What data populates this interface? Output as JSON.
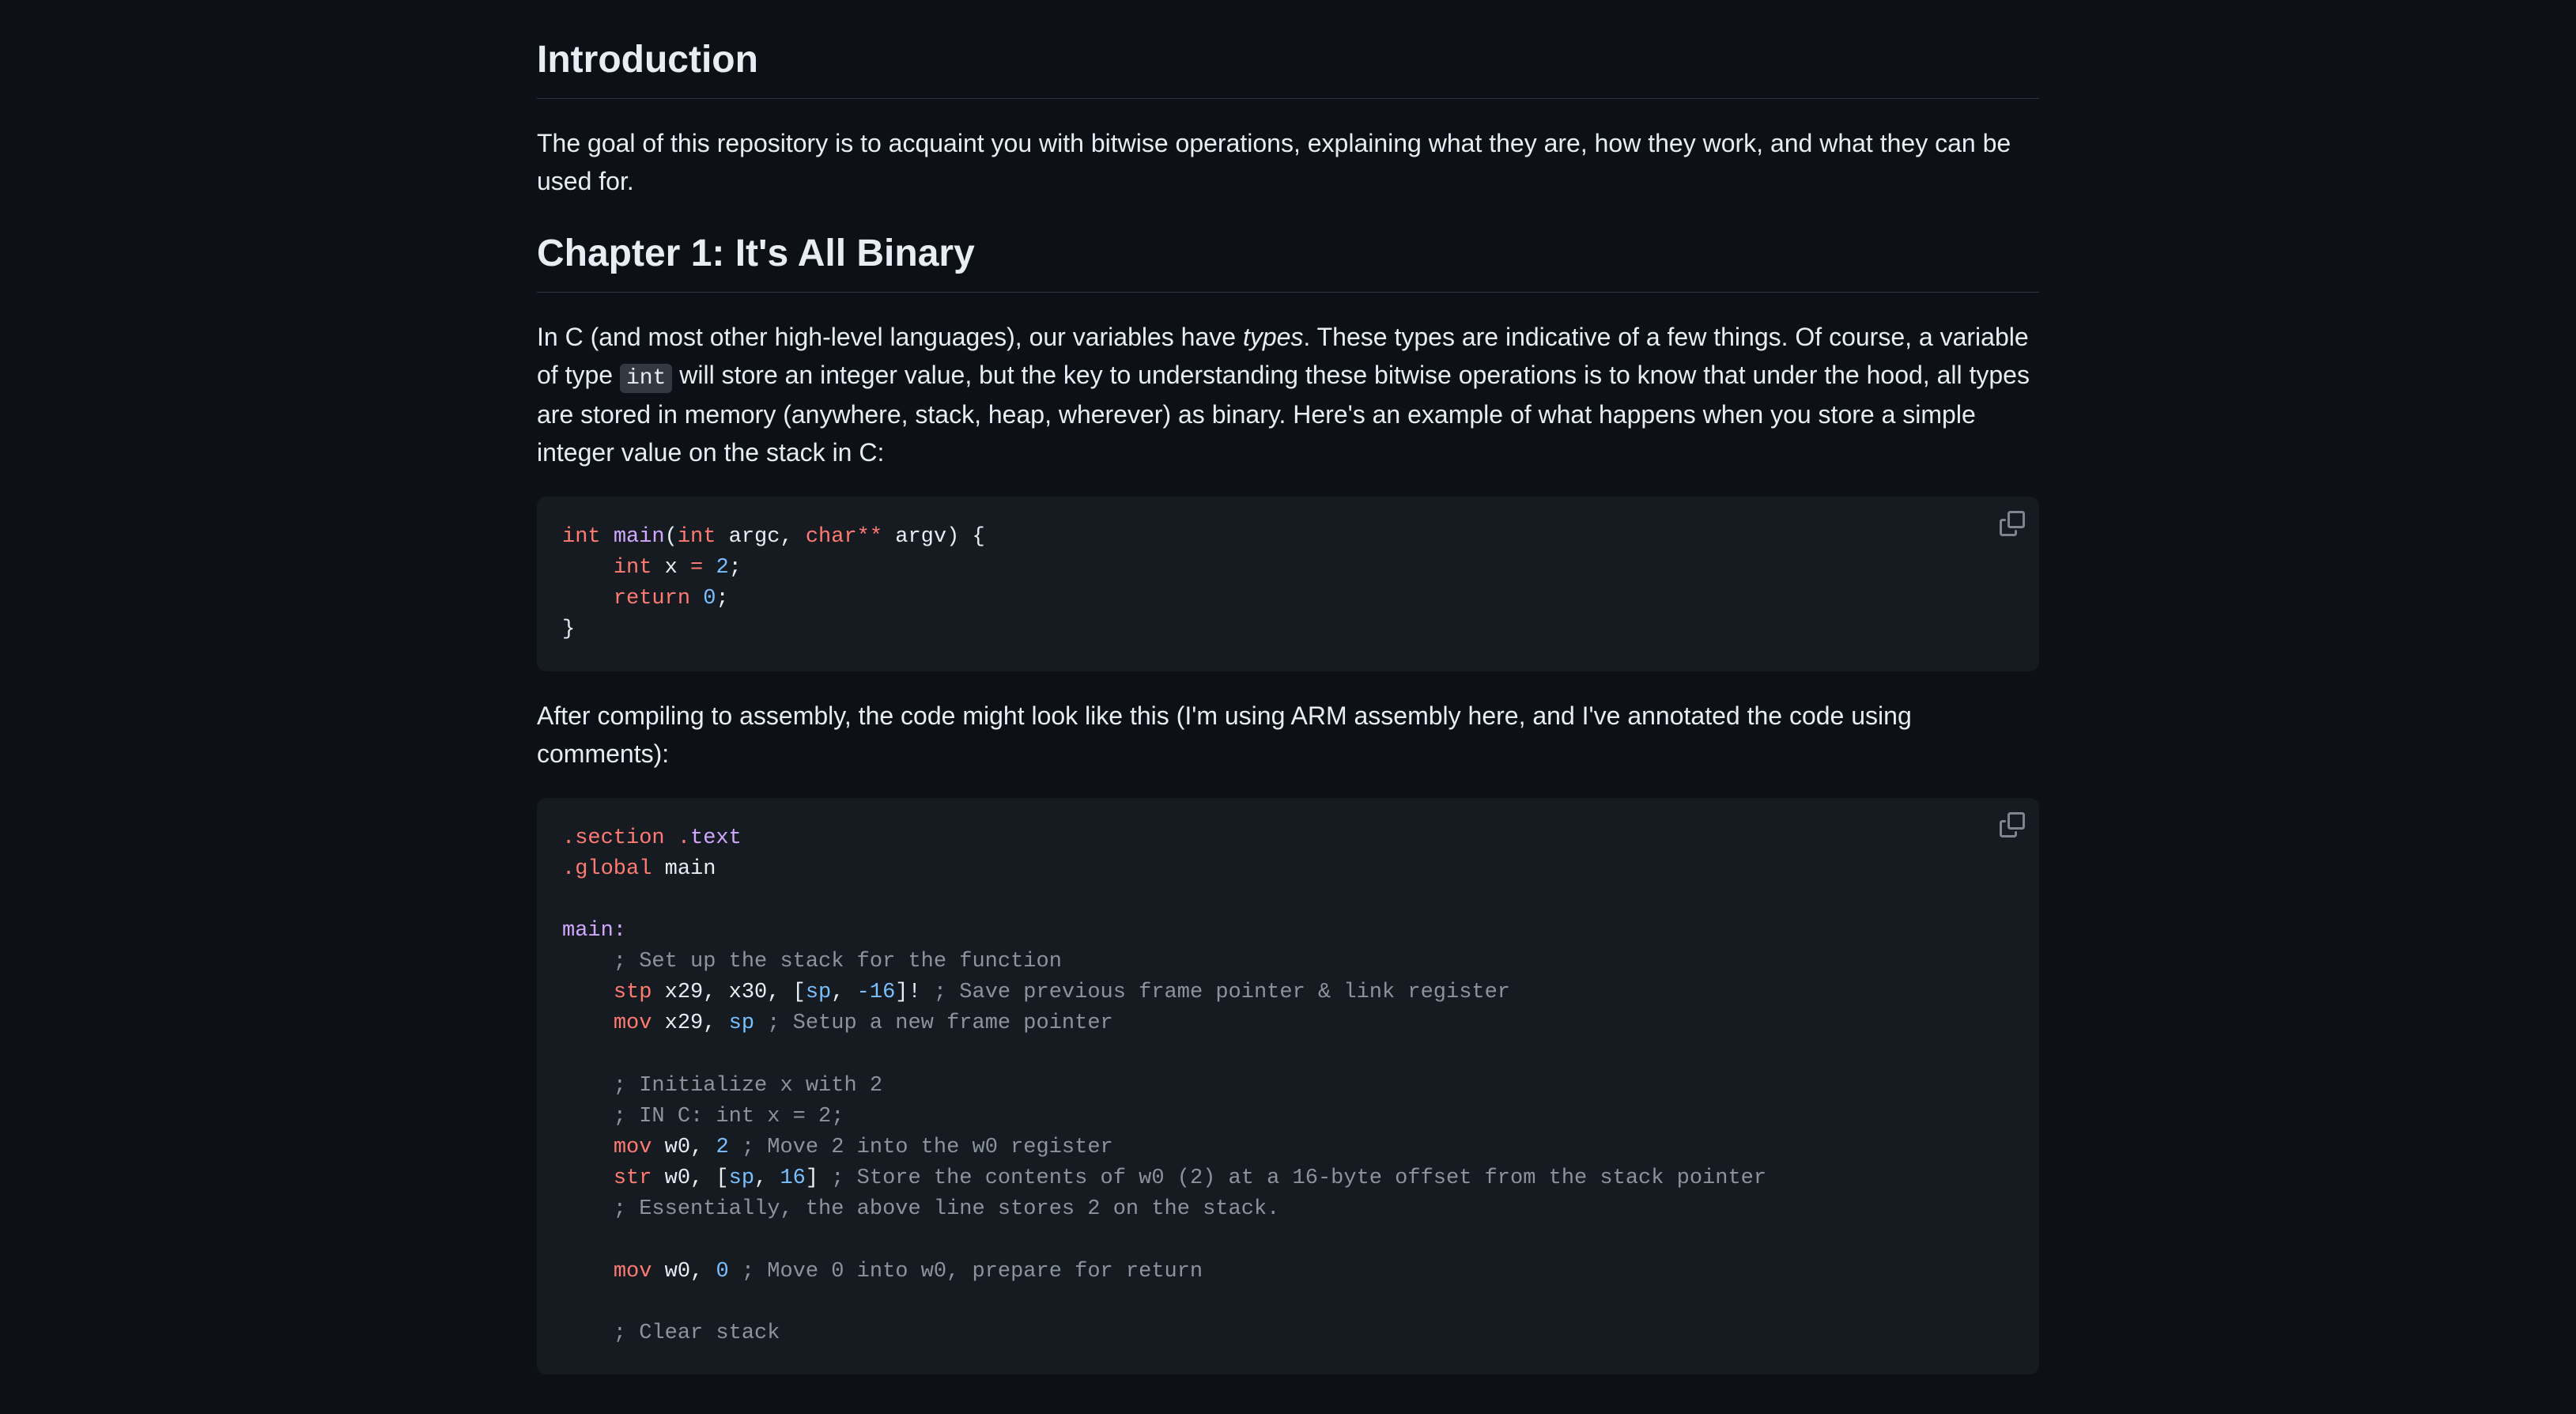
{
  "introduction": {
    "heading": "Introduction",
    "text": "The goal of this repository is to acquaint you with bitwise operations, explaining what they are, how they work, and what they can be used for."
  },
  "chapter1": {
    "heading": "Chapter 1: It's All Binary",
    "para1_prefix": "In C (and most other high-level languages), our variables have ",
    "para1_types": "types",
    "para1_mid1": ". These types are indicative of a few things. Of course, a variable of type ",
    "para1_code": "int",
    "para1_suffix": " will store an integer value, but the key to understanding these bitwise operations is to know that under the hood, all types are stored in memory (anywhere, stack, heap, wherever) as binary. Here's an example of what happens when you store a simple integer value on the stack in C:",
    "para2": "After compiling to assembly, the code might look like this (I'm using ARM assembly here, and I've annotated the code using comments):"
  },
  "code_c": {
    "kw_int1": "int",
    "fn_main": "main",
    "paren_open": "(",
    "kw_int2": "int",
    "argc": " argc, ",
    "kw_char": "char",
    "op_stars": "**",
    "argv_close": " argv) {",
    "line2_indent": "    ",
    "kw_int3": "int",
    "x_eq": " x ",
    "op_eq": "=",
    "sp1": " ",
    "num_2": "2",
    "semi1": ";",
    "line3_indent": "    ",
    "kw_return": "return",
    "sp2": " ",
    "num_0": "0",
    "semi2": ";",
    "close_brace": "}"
  },
  "code_asm": {
    "l1_dot1": ".",
    "l1_section": "section",
    "l1_sp": " ",
    "l1_dot2": ".",
    "l1_text": "text",
    "l2_dot": ".",
    "l2_global": "global",
    "l2_main": " main",
    "l4_main": "main:",
    "l5_comment": "    ; Set up the stack for the function",
    "l6_ind": "    ",
    "l6_stp": "stp",
    "l6_args": " x29, x30, [",
    "l6_sp": "sp",
    "l6_comma": ", ",
    "l6_n16": "-16",
    "l6_tail": "]! ",
    "l6_comment": "; Save previous frame pointer & link register",
    "l7_ind": "    ",
    "l7_mov": "mov",
    "l7_x29": " x29, ",
    "l7_sp": "sp",
    "l7_sp2": " ",
    "l7_comment": "; Setup a new frame pointer",
    "l9_comment": "    ; Initialize x with 2",
    "l10_comment": "    ; IN C: int x = 2;",
    "l11_ind": "    ",
    "l11_mov": "mov",
    "l11_w0": " w0, ",
    "l11_2": "2",
    "l11_sp": " ",
    "l11_comment": "; Move 2 into the w0 register",
    "l12_ind": "    ",
    "l12_str": "str",
    "l12_args": " w0, [",
    "l12_sp": "sp",
    "l12_comma": ", ",
    "l12_16": "16",
    "l12_tail": "] ",
    "l12_comment": "; Store the contents of w0 (2) at a 16-byte offset from the stack pointer",
    "l13_comment": "    ; Essentially, the above line stores 2 on the stack.",
    "l15_ind": "    ",
    "l15_mov": "mov",
    "l15_w0": " w0, ",
    "l15_0": "0",
    "l15_sp": " ",
    "l15_comment": "; Move 0 into w0, prepare for return",
    "l17_comment": "    ; Clear stack"
  }
}
